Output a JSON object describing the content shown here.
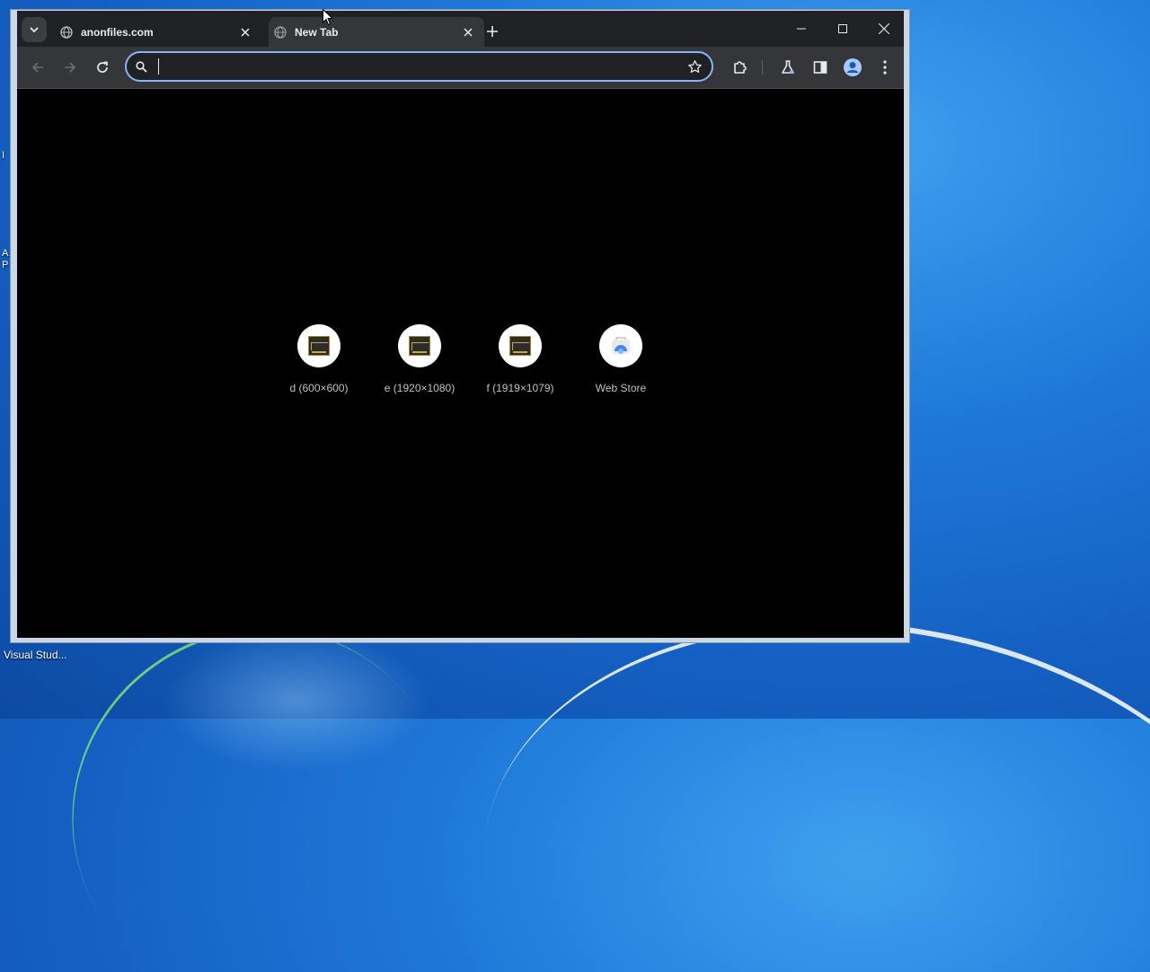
{
  "desktop": {
    "taskbar_label": "Visual Stud...",
    "edge_chars": [
      "I",
      "A",
      "P"
    ]
  },
  "browser": {
    "tabs": [
      {
        "title": "anonfiles.com",
        "active": false
      },
      {
        "title": "New Tab",
        "active": true
      }
    ],
    "omnibox": {
      "value": "",
      "placeholder": ""
    },
    "accent_color": "#8ab4f8",
    "icons": {
      "tab_search": "chevron-down-icon",
      "back": "arrow-left-icon",
      "forward": "arrow-right-icon",
      "reload": "reload-icon",
      "search": "search-icon",
      "bookmark": "star-icon",
      "extensions": "puzzle-icon",
      "labs": "flask-icon",
      "side_panel": "side-panel-icon",
      "profile": "profile-icon",
      "menu": "kebab-menu-icon"
    }
  },
  "shortcuts": [
    {
      "label": "d (600×600)",
      "icon": "image-thumbnail-icon"
    },
    {
      "label": "e (1920×1080)",
      "icon": "image-thumbnail-icon"
    },
    {
      "label": "f (1919×1079)",
      "icon": "image-thumbnail-icon"
    },
    {
      "label": "Web Store",
      "icon": "web-store-icon"
    }
  ]
}
